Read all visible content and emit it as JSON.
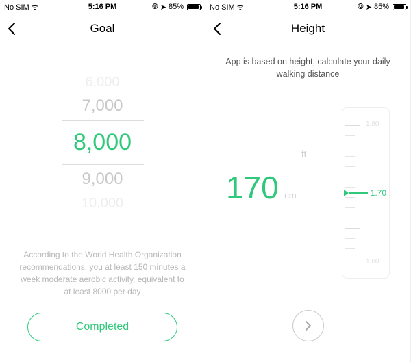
{
  "status": {
    "sim": "No SIM",
    "wifi": "ᯤ",
    "time": "5:16 PM",
    "alarm": "⦾",
    "location": "➤",
    "battery_pct": "85%"
  },
  "goal": {
    "title": "Goal",
    "options": [
      "6,000",
      "7,000",
      "8,000",
      "9,000",
      "10,000"
    ],
    "selected": "8,000",
    "description": "According to the World Health Organization recommendations, you at least 150 minutes a week moderate aerobic activity, equivalent to at least 8000 per day",
    "completed_label": "Completed"
  },
  "height": {
    "title": "Height",
    "description": "App is based on height, calculate your daily walking distance",
    "value": "170",
    "unit_cm": "cm",
    "unit_ft": "ft",
    "ruler_value": "1.70",
    "ruler_top_label": "1.80",
    "ruler_bottom_label": "1.60"
  }
}
